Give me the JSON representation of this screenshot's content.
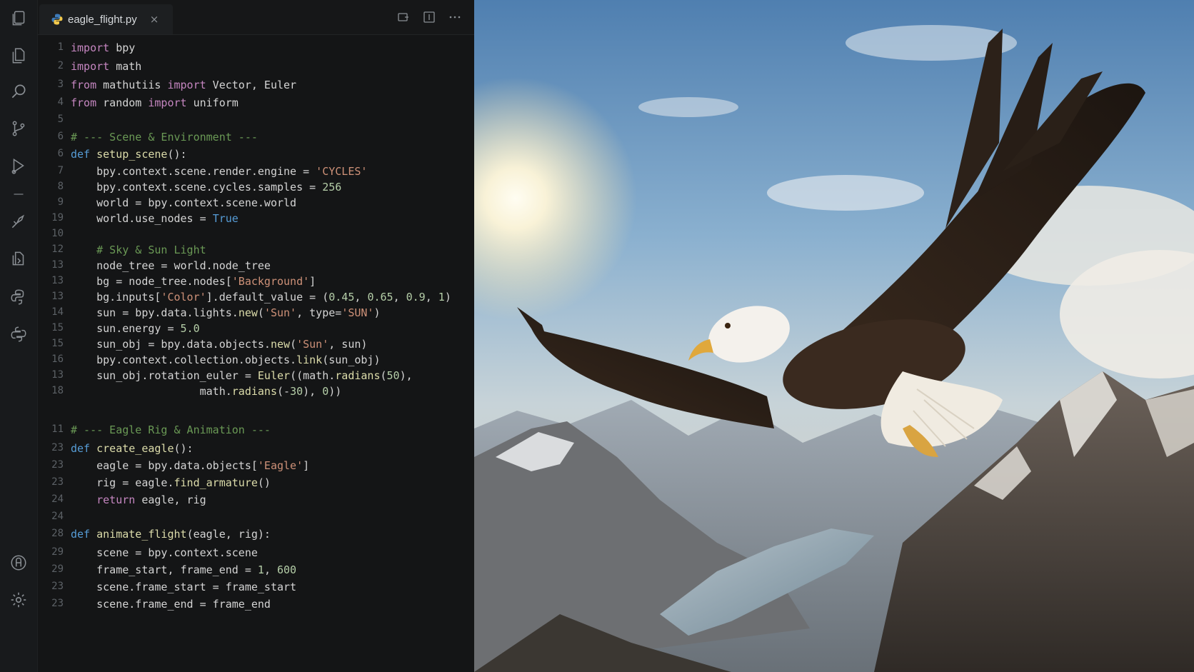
{
  "activity_bar": {
    "icons": [
      "files-icon",
      "explorer-icon",
      "search-icon",
      "source-control-icon",
      "run-debug-icon",
      "extensions-icon",
      "remote-icon",
      "python-icon",
      "python-alt-icon",
      "account-icon",
      "settings-icon"
    ]
  },
  "tab": {
    "filename": "eagle_flight.py",
    "close_glyph": "×"
  },
  "code_lines": [
    {
      "n": "1",
      "t": "import bpy"
    },
    {
      "n": "2",
      "t": "import math"
    },
    {
      "n": "3",
      "t": "from mathutiis import Vector, Euler"
    },
    {
      "n": "4",
      "t": "from random import uniform"
    },
    {
      "n": "5",
      "t": ""
    },
    {
      "n": "6",
      "t": "# --- Scene & Environment ---"
    },
    {
      "n": "6",
      "t": "def setup_scene():"
    },
    {
      "n": "7",
      "t": "    bpy.context.scene.render.engine = 'CYCLES'"
    },
    {
      "n": "8",
      "t": "    bpy.context.scene.cycles.samples = 256"
    },
    {
      "n": "9",
      "t": "    world = bpy.context.scene.world"
    },
    {
      "n": "19",
      "t": "    world.use_nodes = True"
    },
    {
      "n": "10",
      "t": ""
    },
    {
      "n": "12",
      "t": "    # Sky & Sun Light"
    },
    {
      "n": "13",
      "t": "    node_tree = world.node_tree"
    },
    {
      "n": "13",
      "t": "    bg = node_tree.nodes['Background']"
    },
    {
      "n": "13",
      "t": "    bg.inputs['Color'].default_value = (0.45, 0.65, 0.9, 1)"
    },
    {
      "n": "14",
      "t": "    sun = bpy.data.lights.new('Sun', type='SUN')"
    },
    {
      "n": "15",
      "t": "    sun.energy = 5.0"
    },
    {
      "n": "15",
      "t": "    sun_obj = bpy.data.objects.new('Sun', sun)"
    },
    {
      "n": "16",
      "t": "    bpy.context.collection.objects.link(sun_obj)"
    },
    {
      "n": "13",
      "t": "    sun_obj.rotation_euler = Euler((math.radians(50),"
    },
    {
      "n": "18",
      "t": "                    math.radians(-30), 0))"
    },
    {
      "n": "11",
      "t": "# --- Eagle Rig & Animation ---"
    },
    {
      "n": "23",
      "t": "def create_eagle():"
    },
    {
      "n": "23",
      "t": "    eagle = bpy.data.objects['Eagle']"
    },
    {
      "n": "23",
      "t": "    rig = eagle.find_armature()"
    },
    {
      "n": "24",
      "t": "    return eagle, rig"
    },
    {
      "n": "24",
      "t": ""
    },
    {
      "n": "28",
      "t": "def animate_flight(eagle, rig):"
    },
    {
      "n": "29",
      "t": "    scene = bpy.context.scene"
    },
    {
      "n": "29",
      "t": "    frame_start, frame_end = 1, 600"
    },
    {
      "n": "23",
      "t": "    scene.frame_start = frame_start"
    },
    {
      "n": "23",
      "t": "    scene.frame_end = frame_end"
    }
  ],
  "colors": {
    "keyword": "#c586c0",
    "def_keyword": "#569cd6",
    "function": "#dcdcaa",
    "string": "#ce9178",
    "number": "#b5cea8",
    "comment": "#6a9955"
  },
  "scene_image": {
    "subject": "bald-eagle-soaring-over-mountains"
  }
}
